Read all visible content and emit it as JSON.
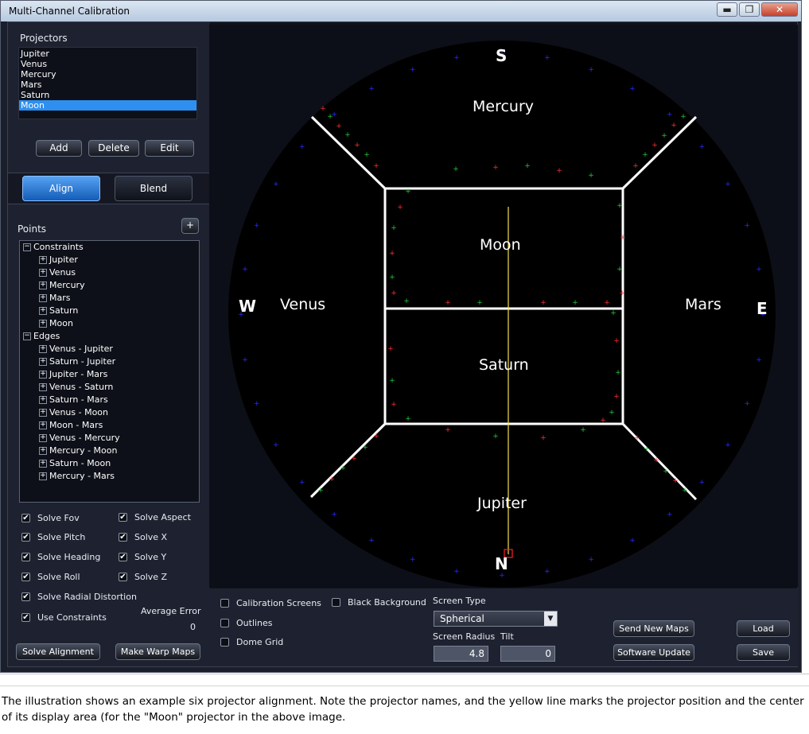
{
  "window": {
    "title": "Multi-Channel Calibration",
    "minimize": "▬",
    "maximize": "❐",
    "close": "✕"
  },
  "projectors": {
    "label": "Projectors",
    "items": [
      "Jupiter",
      "Venus",
      "Mercury",
      "Mars",
      "Saturn",
      "Moon"
    ],
    "selected": "Moon"
  },
  "projector_buttons": {
    "add": "Add",
    "delete": "Delete",
    "edit": "Edit"
  },
  "tabs": {
    "align": "Align",
    "blend": "Blend",
    "active": "Align"
  },
  "points": {
    "label": "Points",
    "add_button": "+"
  },
  "tree": {
    "constraints_label": "Constraints",
    "constraints": [
      "Jupiter",
      "Venus",
      "Mercury",
      "Mars",
      "Saturn",
      "Moon"
    ],
    "edges_label": "Edges",
    "edges": [
      "Venus - Jupiter",
      "Saturn - Jupiter",
      "Jupiter - Mars",
      "Venus - Saturn",
      "Saturn - Mars",
      "Venus - Moon",
      "Moon - Mars",
      "Venus - Mercury",
      "Mercury - Moon",
      "Saturn - Moon",
      "Mercury - Mars"
    ],
    "expand_symbol": "+",
    "collapse_symbol": "−"
  },
  "solve_options": {
    "solve_fov": "Solve Fov",
    "solve_pitch": "Solve Pitch",
    "solve_heading": "Solve Heading",
    "solve_roll": "Solve Roll",
    "solve_aspect": "Solve Aspect",
    "solve_x": "Solve X",
    "solve_y": "Solve Y",
    "solve_z": "Solve Z",
    "solve_radial": "Solve Radial Distortion",
    "use_constraints": "Use Constraints",
    "check_mark": "✔"
  },
  "average_error": {
    "label": "Average Error",
    "value": "0"
  },
  "left_buttons": {
    "solve": "Solve Alignment",
    "warp": "Make Warp Maps"
  },
  "viewport": {
    "compass": {
      "s": "S",
      "n": "N",
      "w": "W",
      "e": "E"
    },
    "regions": {
      "mercury": "Mercury",
      "moon": "Moon",
      "venus": "Venus",
      "mars": "Mars",
      "saturn": "Saturn",
      "jupiter": "Jupiter"
    },
    "colors": {
      "background": "#000000",
      "outline": "#ffffff",
      "projector_line": "#f2e14a",
      "marker": "#ff2020",
      "point_red": "#ff3030",
      "point_green": "#22c83a",
      "point_blue": "#2a2aff"
    }
  },
  "options": {
    "calibration_screens": "Calibration Screens",
    "outlines": "Outlines",
    "dome_grid": "Dome Grid",
    "black_background": "Black Background"
  },
  "screen": {
    "type_label": "Screen Type",
    "type_value": "Spherical",
    "combo_arrow": "▼",
    "radius_label": "Screen Radius",
    "radius_value": "4.8",
    "tilt_label": "Tilt",
    "tilt_value": "0"
  },
  "right_buttons": {
    "send_maps": "Send New Maps",
    "software_update": "Software Update",
    "load": "Load",
    "save": "Save"
  },
  "caption": "The illustration shows an example six projector alignment. Note the projector names, and the yellow line marks the projector position and the center of its display area (for the \"Moon\" projector in the above image."
}
